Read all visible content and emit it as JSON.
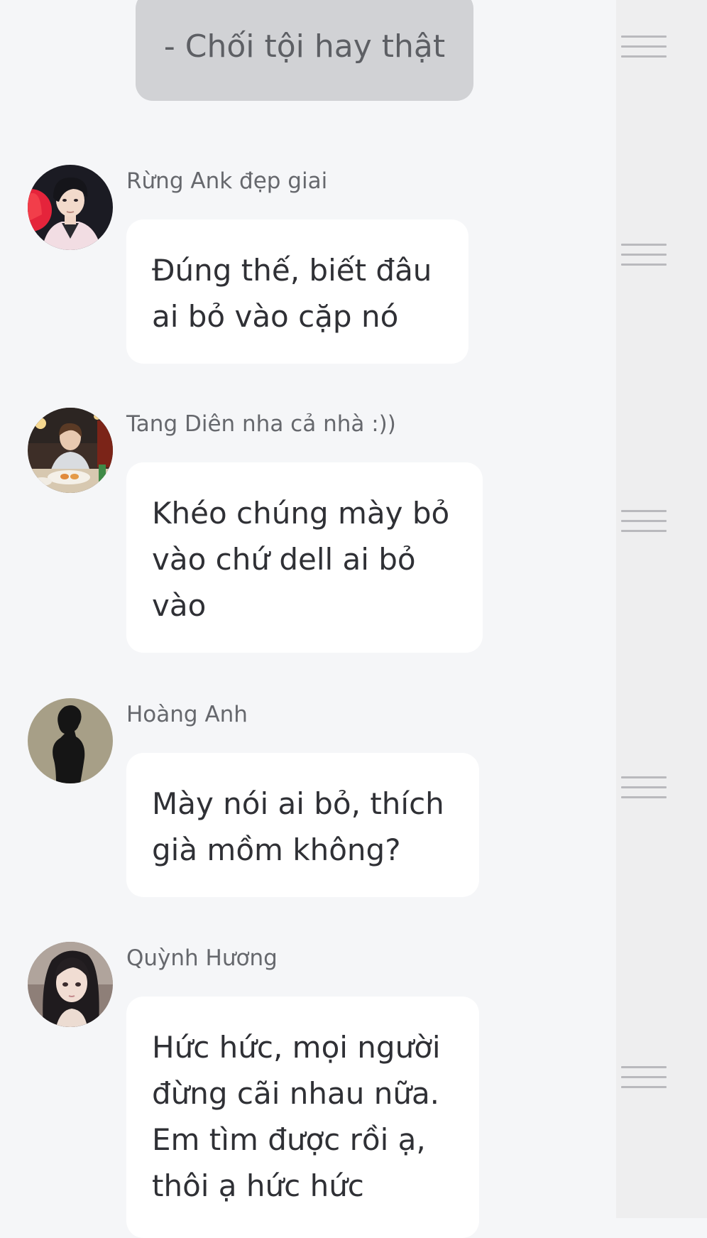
{
  "narration": {
    "text": "- Chối tội hay thật"
  },
  "messages": [
    {
      "sender": "Rừng Ank đẹp giai",
      "avatar_icon": "male-portrait-avatar",
      "lines": [
        "Đúng thế, biết đâu",
        "ai bỏ vào cặp nó"
      ]
    },
    {
      "sender": "Tang Diên nha cả nhà :))",
      "avatar_icon": "dining-photo-avatar",
      "lines": [
        "Khéo chúng mày bỏ",
        "vào chứ dell ai bỏ",
        "vào"
      ]
    },
    {
      "sender": "Hoàng Anh",
      "avatar_icon": "silhouette-avatar",
      "lines": [
        "Mày nói ai bỏ, thích",
        "già mồm không?"
      ]
    },
    {
      "sender": "Quỳnh Hương",
      "avatar_icon": "anime-girl-avatar",
      "lines": [
        "Hức hức, mọi người",
        "đừng cãi nhau nữa.",
        "Em tìm được rồi ạ,",
        "thôi ạ hức hức"
      ]
    }
  ],
  "side_rail": {
    "handle_icon": "drag-handle-icon",
    "handle_count": 5
  },
  "colors": {
    "background": "#f5f6f8",
    "narration_bubble": "#d1d2d5",
    "message_bubble": "#ffffff",
    "side_rail": "#eeeeef",
    "handle": "#b9b9bd"
  }
}
